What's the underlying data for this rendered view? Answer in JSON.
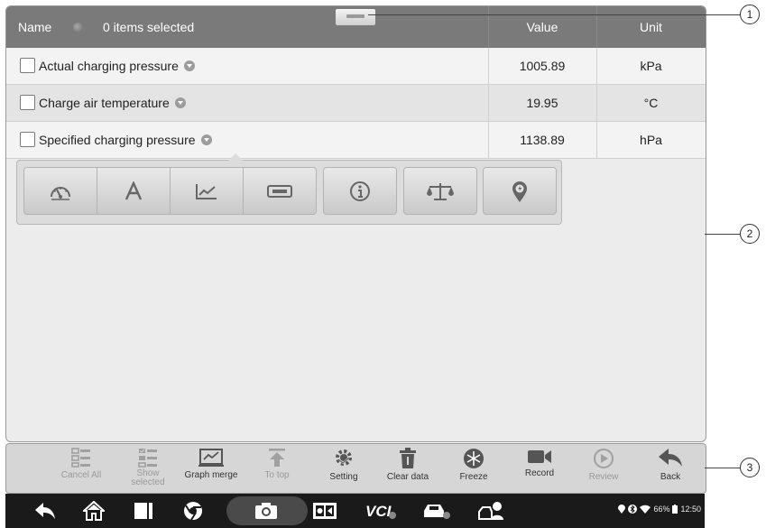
{
  "header": {
    "name_label": "Name",
    "selection_text": "0 items selected",
    "value_label": "Value",
    "unit_label": "Unit"
  },
  "rows": [
    {
      "name": "Actual charging pressure",
      "value": "1005.89",
      "unit": "kPa"
    },
    {
      "name": "Charge air temperature",
      "value": "19.95",
      "unit": "°C"
    },
    {
      "name": "Specified charging pressure",
      "value": "1138.89",
      "unit": "hPa"
    }
  ],
  "popup_icons": [
    "gauge-icon",
    "text-icon",
    "line-graph-icon",
    "digital-display-icon",
    "info-icon",
    "scale-icon",
    "location-pin-icon"
  ],
  "toolbar": {
    "cancel_all": "Cancel All",
    "show_selected_1": "Show",
    "show_selected_2": "selected",
    "graph_merge": "Graph merge",
    "to_top": "To top",
    "setting": "Setting",
    "clear_data": "Clear data",
    "freeze": "Freeze",
    "record": "Record",
    "review": "Review",
    "back": "Back"
  },
  "status": {
    "battery": "66%",
    "time": "12:50"
  },
  "callouts": [
    "1",
    "2",
    "3"
  ],
  "colors": {
    "header": "#7a7a7a",
    "body": "#ececec",
    "toolbar": "#d6d6d6",
    "navbar": "#1a1a1a"
  }
}
